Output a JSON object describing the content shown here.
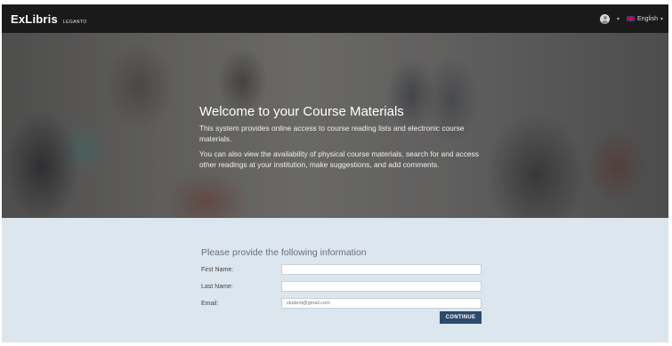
{
  "header": {
    "logo_main": "ExLibris",
    "logo_sub": "LEGANTO",
    "language": "English"
  },
  "hero": {
    "title": "Welcome to your Course Materials",
    "paragraph1": "This system provides online access to course reading lists and electronic course materials.",
    "paragraph2": "You can also view the availability of physical course materials, search for and access other readings at your institution, make suggestions, and add comments."
  },
  "form": {
    "heading": "Please provide the following information",
    "first_name_label": "First Name:",
    "first_name_value": "",
    "last_name_label": "Last Name:",
    "last_name_value": "",
    "email_label": "Email:",
    "email_placeholder": "student@gmail.com",
    "continue_label": "CONTINUE"
  },
  "colors": {
    "topbar": "#1a1a1a",
    "form_background": "#dce6ee",
    "button": "#2a4a6e"
  }
}
